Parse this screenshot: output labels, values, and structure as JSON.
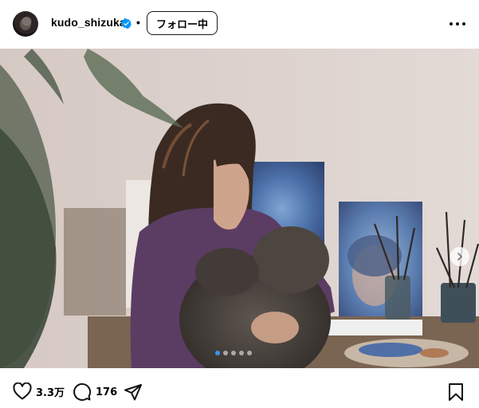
{
  "post": {
    "username": "kudo_shizuka",
    "verified": true,
    "separator": "•",
    "follow_label": "フォロー中",
    "more_icon": "more-horizontal-icon"
  },
  "photo": {
    "alt_subject": "woman holding a dog in an art studio",
    "carousel": {
      "total": 5,
      "active": 0
    }
  },
  "actions": {
    "likes": "3.3万",
    "comments": "176",
    "like_icon": "heart-icon",
    "comment_icon": "comment-icon",
    "share_icon": "share-icon",
    "save_icon": "bookmark-icon"
  },
  "colors": {
    "accent": "#3897f0",
    "wall": "#d9cfcc",
    "sweater": "#5b3c63"
  }
}
